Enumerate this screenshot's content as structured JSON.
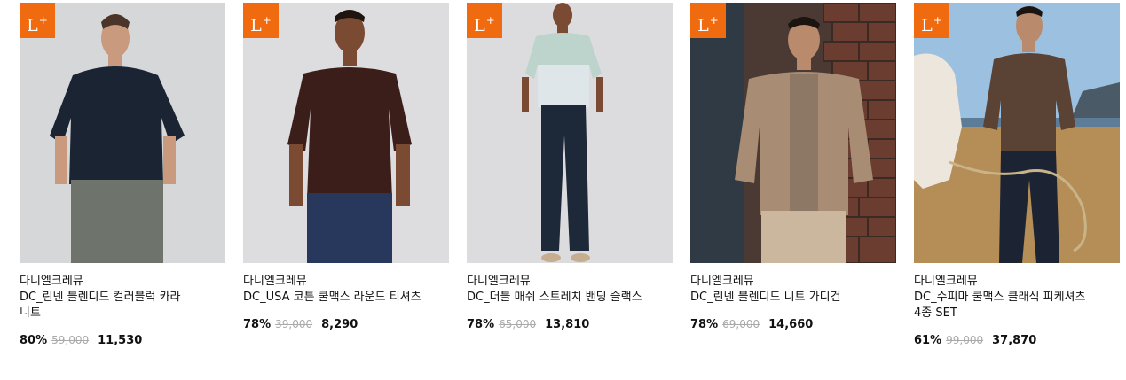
{
  "badge": {
    "letter": "L",
    "sup": "+",
    "color": "#f06a0f"
  },
  "products": [
    {
      "brand": "다니엘크레뮤",
      "name": "DC_린넨 블렌디드 컬러블럭 카라 니트",
      "discount": "80%",
      "original_price": "59,000",
      "sale_price": "11,530",
      "image_icon": "model-photo-navy-polo"
    },
    {
      "brand": "다니엘크레뮤",
      "name": "DC_USA 코튼 쿨맥스 라운드 티셔츠",
      "discount": "78%",
      "original_price": "39,000",
      "sale_price": "8,290",
      "image_icon": "model-photo-brown-tee"
    },
    {
      "brand": "다니엘크레뮤",
      "name": "DC_더블 매쉬 스트레치 밴딩 슬랙스",
      "discount": "78%",
      "original_price": "65,000",
      "sale_price": "13,810",
      "image_icon": "model-photo-navy-slacks"
    },
    {
      "brand": "다니엘크레뮤",
      "name": "DC_린넨 블렌디드 니트 가디건",
      "discount": "78%",
      "original_price": "69,000",
      "sale_price": "14,660",
      "image_icon": "model-photo-beige-cardigan"
    },
    {
      "brand": "다니엘크레뮤",
      "name": "DC_수피마 쿨맥스 클래식 피케셔츠 4종 SET",
      "discount": "61%",
      "original_price": "99,000",
      "sale_price": "37,870",
      "image_icon": "model-photo-brown-pique-horse"
    }
  ]
}
